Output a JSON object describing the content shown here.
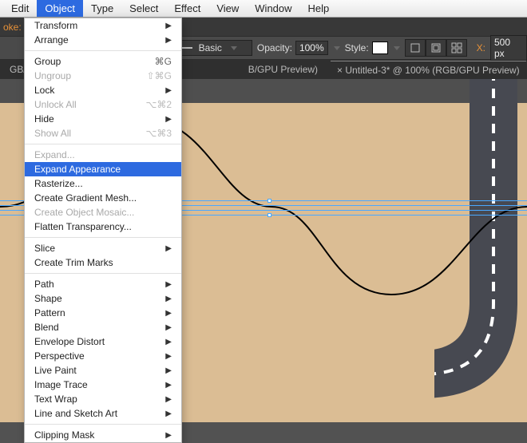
{
  "menubar": {
    "items": [
      "Edit",
      "Object",
      "Type",
      "Select",
      "Effect",
      "View",
      "Window",
      "Help"
    ],
    "open_index": 1
  },
  "stroke_label": "oke:",
  "toolbar": {
    "basic": "Basic",
    "opacity_label": "Opacity:",
    "opacity_value": "100%",
    "style_label": "Style:",
    "x_label": "X:",
    "x_value": "500 px"
  },
  "tabs": {
    "left": "GB/GPU Preview)",
    "right_prefix": "×  Untitled-3* @ 100% (RGB/GPU Preview)",
    "right_label": "B/GPU Preview)"
  },
  "dropdown": {
    "groups": [
      [
        {
          "label": "Transform",
          "sub": true
        },
        {
          "label": "Arrange",
          "sub": true
        }
      ],
      [
        {
          "label": "Group",
          "shortcut": "⌘G"
        },
        {
          "label": "Ungroup",
          "shortcut": "⇧⌘G",
          "disabled": true
        },
        {
          "label": "Lock",
          "sub": true
        },
        {
          "label": "Unlock All",
          "shortcut": "⌥⌘2",
          "disabled": true
        },
        {
          "label": "Hide",
          "sub": true
        },
        {
          "label": "Show All",
          "shortcut": "⌥⌘3",
          "disabled": true
        }
      ],
      [
        {
          "label": "Expand...",
          "disabled": true
        },
        {
          "label": "Expand Appearance",
          "highlight": true
        },
        {
          "label": "Rasterize..."
        },
        {
          "label": "Create Gradient Mesh..."
        },
        {
          "label": "Create Object Mosaic...",
          "disabled": true
        },
        {
          "label": "Flatten Transparency..."
        }
      ],
      [
        {
          "label": "Slice",
          "sub": true
        },
        {
          "label": "Create Trim Marks"
        }
      ],
      [
        {
          "label": "Path",
          "sub": true
        },
        {
          "label": "Shape",
          "sub": true
        },
        {
          "label": "Pattern",
          "sub": true
        },
        {
          "label": "Blend",
          "sub": true
        },
        {
          "label": "Envelope Distort",
          "sub": true
        },
        {
          "label": "Perspective",
          "sub": true
        },
        {
          "label": "Live Paint",
          "sub": true
        },
        {
          "label": "Image Trace",
          "sub": true
        },
        {
          "label": "Text Wrap",
          "sub": true
        },
        {
          "label": "Line and Sketch Art",
          "sub": true
        }
      ],
      [
        {
          "label": "Clipping Mask",
          "sub": true,
          "disabled": false
        }
      ]
    ]
  },
  "colors": {
    "artboard": "#dbbd94",
    "road": "#474951",
    "guide": "#4aa8ff"
  }
}
